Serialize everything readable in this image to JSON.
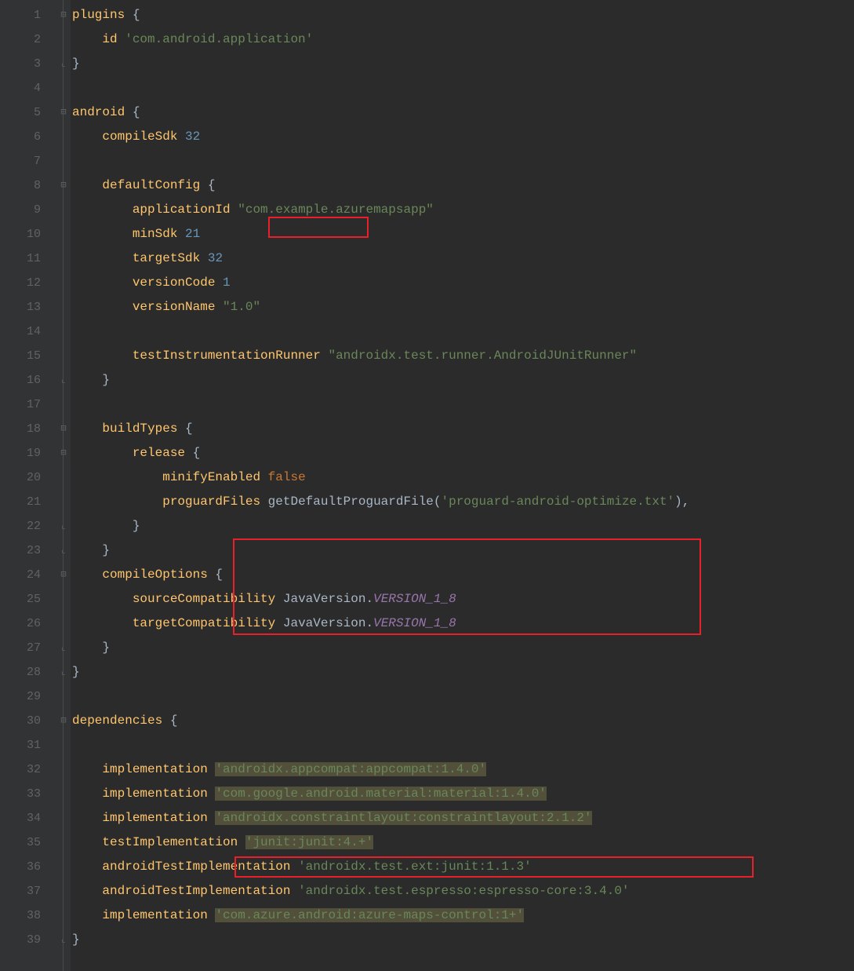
{
  "lines": {
    "n1": "1",
    "n2": "2",
    "n3": "3",
    "n4": "4",
    "n5": "5",
    "n6": "6",
    "n7": "7",
    "n8": "8",
    "n9": "9",
    "n10": "10",
    "n11": "11",
    "n12": "12",
    "n13": "13",
    "n14": "14",
    "n15": "15",
    "n16": "16",
    "n17": "17",
    "n18": "18",
    "n19": "19",
    "n20": "20",
    "n21": "21",
    "n22": "22",
    "n23": "23",
    "n24": "24",
    "n25": "25",
    "n26": "26",
    "n27": "27",
    "n28": "28",
    "n29": "29",
    "n30": "30",
    "n31": "31",
    "n32": "32",
    "n33": "33",
    "n34": "34",
    "n35": "35",
    "n36": "36",
    "n37": "37",
    "n38": "38",
    "n39": "39"
  },
  "tok": {
    "plugins": "plugins",
    "lb": " {",
    "rb": "}",
    "id": "id",
    "sp4": "    ",
    "sp8": "        ",
    "sp12": "            ",
    "app_plugin": "'com.android.application'",
    "android": "android",
    "compileSdk": "compileSdk",
    "v32": "32",
    "defaultConfig": "defaultConfig",
    "applicationId": "applicationId",
    "appid_str": "\"com.example.azuremapsapp\"",
    "minSdk": "minSdk",
    "v21": "21",
    "targetSdk": "targetSdk",
    "versionCode": "versionCode",
    "v1": "1",
    "versionName": "versionName",
    "v1_0": "\"1.0\"",
    "testRunner": "testInstrumentationRunner",
    "runner_str": "\"androidx.test.runner.AndroidJUnitRunner\"",
    "buildTypes": "buildTypes",
    "release": "release",
    "minifyEnabled": "minifyEnabled",
    "false": "false",
    "proguardFiles": "proguardFiles",
    "getDefaultProguardFile": "getDefaultProguardFile",
    "proguard_str": "'proguard-android-optimize.txt'",
    "compileOptions": "compileOptions",
    "sourceCompat": "sourceCompatibility",
    "targetCompat": "targetCompatibility",
    "JavaVersion": "JavaVersion",
    "VERSION_1_8": "VERSION_1_8",
    "dependencies": "dependencies",
    "implementation": "implementation",
    "testImplementation": "testImplementation",
    "androidTestImplementation": "androidTestImplementation",
    "dep_appcompat": "'androidx.appcompat:appcompat:1.4.0'",
    "dep_material": "'com.google.android.material:material:1.4.0'",
    "dep_constraint": "'androidx.constraintlayout:constraintlayout:2.1.2'",
    "dep_junit": "'junit:junit:4.+'",
    "dep_extjunit": "'androidx.test.ext:junit:1.1.3'",
    "dep_espresso": "'androidx.test.espresso:espresso-core:3.4.0'",
    "dep_azure": "'com.azure.android:azure-maps-control:1+'",
    "dot": ".",
    "paren_o": "(",
    "paren_c": "),",
    "space": " "
  }
}
